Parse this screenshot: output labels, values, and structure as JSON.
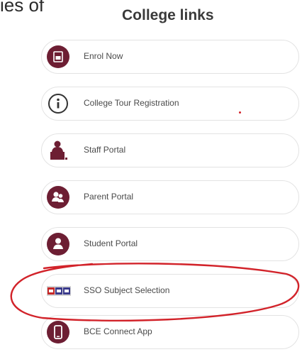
{
  "cutoff_text": "ies of",
  "title": "College links",
  "links": [
    {
      "label": "Enrol Now",
      "icon": "enrol-form-icon"
    },
    {
      "label": "College Tour Registration",
      "icon": "info-icon"
    },
    {
      "label": "Staff Portal",
      "icon": "staff-desk-icon"
    },
    {
      "label": "Parent Portal",
      "icon": "parent-people-icon"
    },
    {
      "label": "Student Portal",
      "icon": "student-person-icon"
    },
    {
      "label": "SSO Subject Selection",
      "icon": "sso-logo-icon"
    },
    {
      "label": "BCE Connect App",
      "icon": "phone-icon"
    }
  ],
  "colors": {
    "accent": "#6d1e33",
    "annotation": "#d2232a"
  }
}
